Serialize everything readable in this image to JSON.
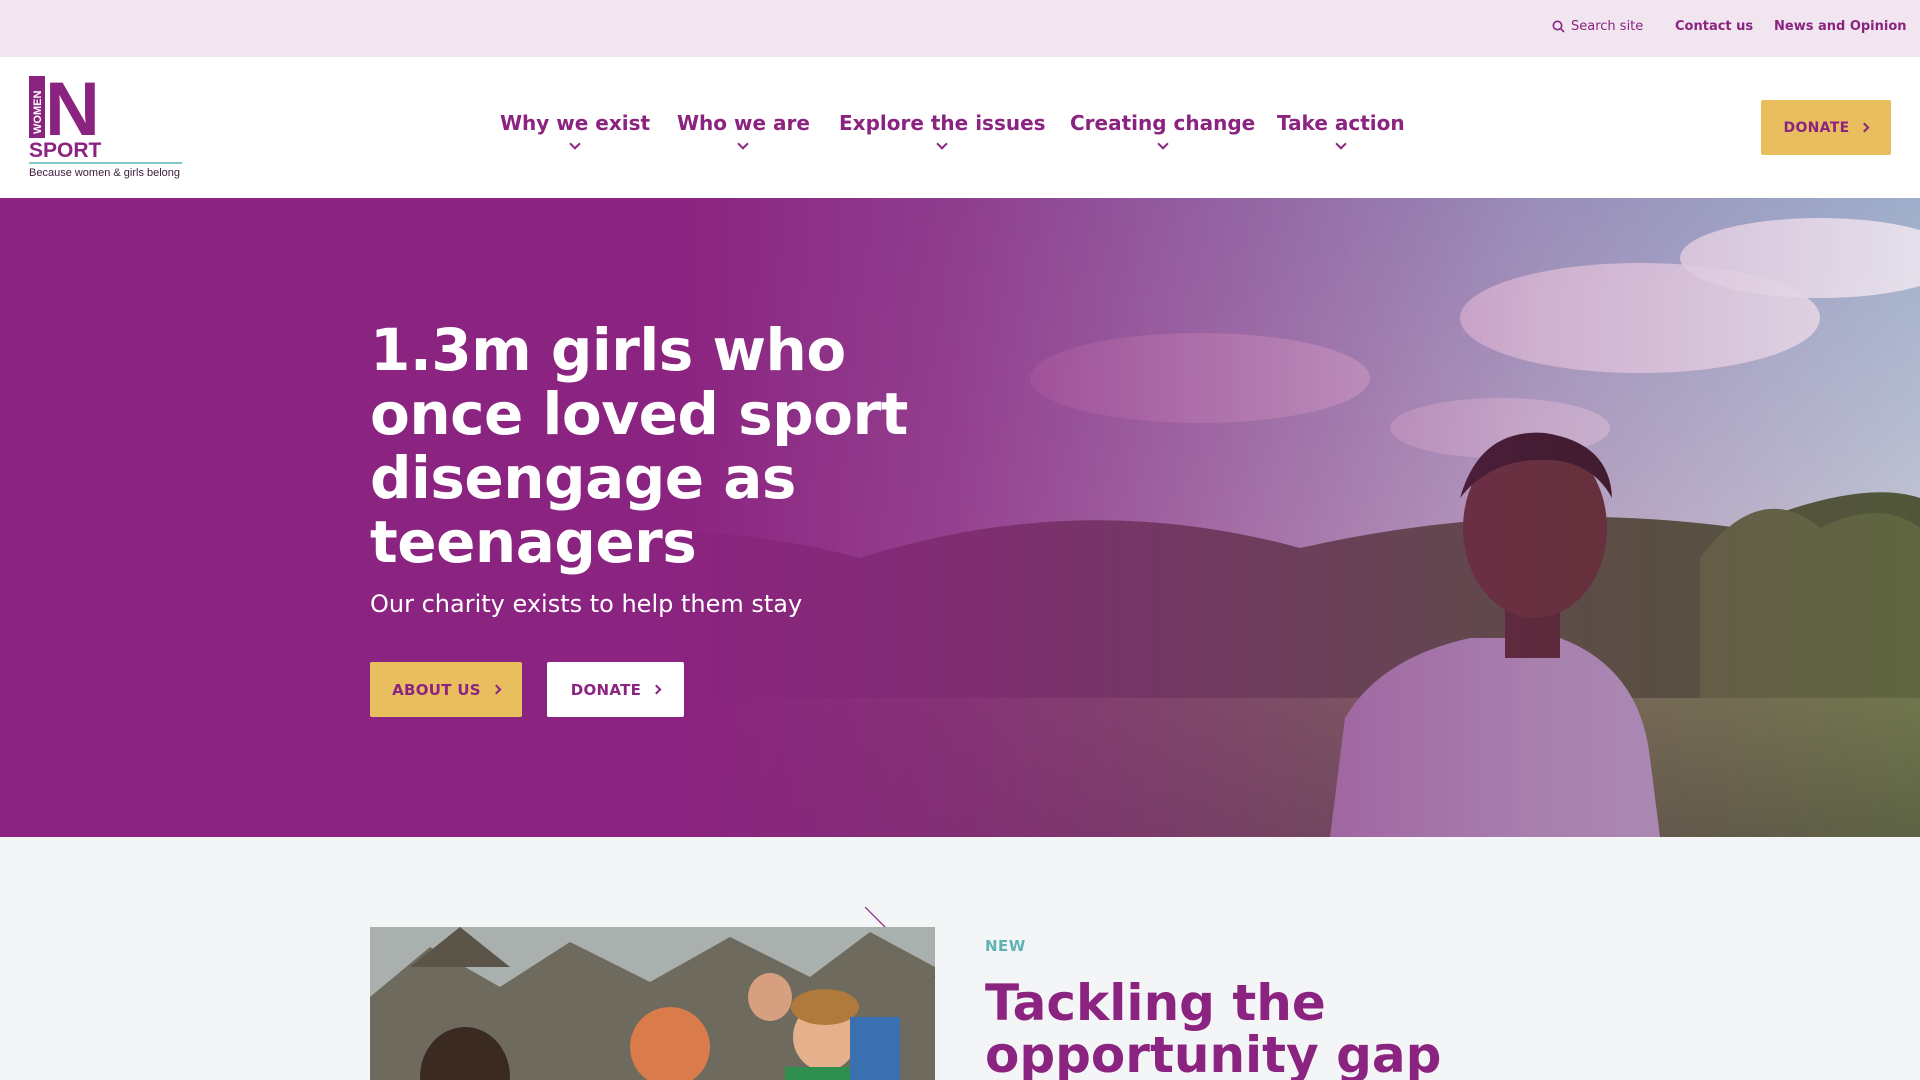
{
  "utility": {
    "search_label": "Search site",
    "contact_label": "Contact us",
    "news_label": "News and Opinion"
  },
  "logo": {
    "word_women": "WOMEN",
    "letter_in": "N",
    "word_sport": "SPORT",
    "tagline": "Because women & girls belong"
  },
  "nav": {
    "items": [
      {
        "label": "Why we exist"
      },
      {
        "label": "Who we are"
      },
      {
        "label": "Explore the issues"
      },
      {
        "label": "Creating change"
      },
      {
        "label": "Take action"
      }
    ]
  },
  "header": {
    "donate_label": "DONATE"
  },
  "hero": {
    "title": "1.3m girls who once loved sport disengage as teenagers",
    "subtitle": "Our charity exists to help them stay",
    "about_label": "ABOUT US",
    "donate_label": "DONATE"
  },
  "feature": {
    "tag": "NEW",
    "title": "Tackling the opportunity gap"
  },
  "colors": {
    "brand_purple": "#8b2380",
    "accent_gold": "#e9be5e",
    "accent_teal": "#5fb3b3",
    "utility_bg": "#f1e6f0"
  }
}
